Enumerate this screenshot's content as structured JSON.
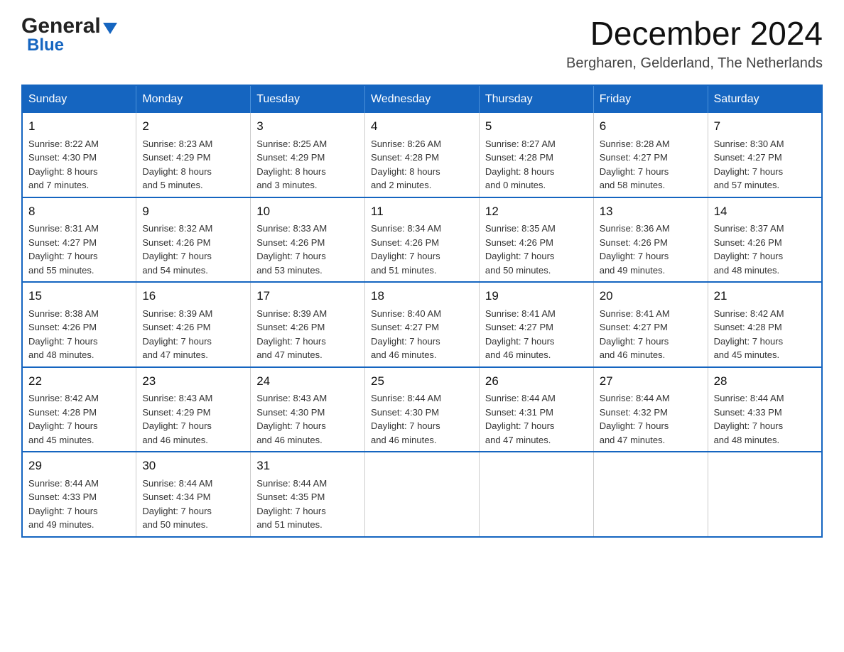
{
  "logo": {
    "general": "General",
    "blue": "Blue",
    "triangle": true
  },
  "title": {
    "month_year": "December 2024",
    "location": "Bergharen, Gelderland, The Netherlands"
  },
  "days_of_week": [
    "Sunday",
    "Monday",
    "Tuesday",
    "Wednesday",
    "Thursday",
    "Friday",
    "Saturday"
  ],
  "weeks": [
    [
      {
        "day": "1",
        "sunrise": "Sunrise: 8:22 AM",
        "sunset": "Sunset: 4:30 PM",
        "daylight": "Daylight: 8 hours",
        "daylight2": "and 7 minutes."
      },
      {
        "day": "2",
        "sunrise": "Sunrise: 8:23 AM",
        "sunset": "Sunset: 4:29 PM",
        "daylight": "Daylight: 8 hours",
        "daylight2": "and 5 minutes."
      },
      {
        "day": "3",
        "sunrise": "Sunrise: 8:25 AM",
        "sunset": "Sunset: 4:29 PM",
        "daylight": "Daylight: 8 hours",
        "daylight2": "and 3 minutes."
      },
      {
        "day": "4",
        "sunrise": "Sunrise: 8:26 AM",
        "sunset": "Sunset: 4:28 PM",
        "daylight": "Daylight: 8 hours",
        "daylight2": "and 2 minutes."
      },
      {
        "day": "5",
        "sunrise": "Sunrise: 8:27 AM",
        "sunset": "Sunset: 4:28 PM",
        "daylight": "Daylight: 8 hours",
        "daylight2": "and 0 minutes."
      },
      {
        "day": "6",
        "sunrise": "Sunrise: 8:28 AM",
        "sunset": "Sunset: 4:27 PM",
        "daylight": "Daylight: 7 hours",
        "daylight2": "and 58 minutes."
      },
      {
        "day": "7",
        "sunrise": "Sunrise: 8:30 AM",
        "sunset": "Sunset: 4:27 PM",
        "daylight": "Daylight: 7 hours",
        "daylight2": "and 57 minutes."
      }
    ],
    [
      {
        "day": "8",
        "sunrise": "Sunrise: 8:31 AM",
        "sunset": "Sunset: 4:27 PM",
        "daylight": "Daylight: 7 hours",
        "daylight2": "and 55 minutes."
      },
      {
        "day": "9",
        "sunrise": "Sunrise: 8:32 AM",
        "sunset": "Sunset: 4:26 PM",
        "daylight": "Daylight: 7 hours",
        "daylight2": "and 54 minutes."
      },
      {
        "day": "10",
        "sunrise": "Sunrise: 8:33 AM",
        "sunset": "Sunset: 4:26 PM",
        "daylight": "Daylight: 7 hours",
        "daylight2": "and 53 minutes."
      },
      {
        "day": "11",
        "sunrise": "Sunrise: 8:34 AM",
        "sunset": "Sunset: 4:26 PM",
        "daylight": "Daylight: 7 hours",
        "daylight2": "and 51 minutes."
      },
      {
        "day": "12",
        "sunrise": "Sunrise: 8:35 AM",
        "sunset": "Sunset: 4:26 PM",
        "daylight": "Daylight: 7 hours",
        "daylight2": "and 50 minutes."
      },
      {
        "day": "13",
        "sunrise": "Sunrise: 8:36 AM",
        "sunset": "Sunset: 4:26 PM",
        "daylight": "Daylight: 7 hours",
        "daylight2": "and 49 minutes."
      },
      {
        "day": "14",
        "sunrise": "Sunrise: 8:37 AM",
        "sunset": "Sunset: 4:26 PM",
        "daylight": "Daylight: 7 hours",
        "daylight2": "and 48 minutes."
      }
    ],
    [
      {
        "day": "15",
        "sunrise": "Sunrise: 8:38 AM",
        "sunset": "Sunset: 4:26 PM",
        "daylight": "Daylight: 7 hours",
        "daylight2": "and 48 minutes."
      },
      {
        "day": "16",
        "sunrise": "Sunrise: 8:39 AM",
        "sunset": "Sunset: 4:26 PM",
        "daylight": "Daylight: 7 hours",
        "daylight2": "and 47 minutes."
      },
      {
        "day": "17",
        "sunrise": "Sunrise: 8:39 AM",
        "sunset": "Sunset: 4:26 PM",
        "daylight": "Daylight: 7 hours",
        "daylight2": "and 47 minutes."
      },
      {
        "day": "18",
        "sunrise": "Sunrise: 8:40 AM",
        "sunset": "Sunset: 4:27 PM",
        "daylight": "Daylight: 7 hours",
        "daylight2": "and 46 minutes."
      },
      {
        "day": "19",
        "sunrise": "Sunrise: 8:41 AM",
        "sunset": "Sunset: 4:27 PM",
        "daylight": "Daylight: 7 hours",
        "daylight2": "and 46 minutes."
      },
      {
        "day": "20",
        "sunrise": "Sunrise: 8:41 AM",
        "sunset": "Sunset: 4:27 PM",
        "daylight": "Daylight: 7 hours",
        "daylight2": "and 46 minutes."
      },
      {
        "day": "21",
        "sunrise": "Sunrise: 8:42 AM",
        "sunset": "Sunset: 4:28 PM",
        "daylight": "Daylight: 7 hours",
        "daylight2": "and 45 minutes."
      }
    ],
    [
      {
        "day": "22",
        "sunrise": "Sunrise: 8:42 AM",
        "sunset": "Sunset: 4:28 PM",
        "daylight": "Daylight: 7 hours",
        "daylight2": "and 45 minutes."
      },
      {
        "day": "23",
        "sunrise": "Sunrise: 8:43 AM",
        "sunset": "Sunset: 4:29 PM",
        "daylight": "Daylight: 7 hours",
        "daylight2": "and 46 minutes."
      },
      {
        "day": "24",
        "sunrise": "Sunrise: 8:43 AM",
        "sunset": "Sunset: 4:30 PM",
        "daylight": "Daylight: 7 hours",
        "daylight2": "and 46 minutes."
      },
      {
        "day": "25",
        "sunrise": "Sunrise: 8:44 AM",
        "sunset": "Sunset: 4:30 PM",
        "daylight": "Daylight: 7 hours",
        "daylight2": "and 46 minutes."
      },
      {
        "day": "26",
        "sunrise": "Sunrise: 8:44 AM",
        "sunset": "Sunset: 4:31 PM",
        "daylight": "Daylight: 7 hours",
        "daylight2": "and 47 minutes."
      },
      {
        "day": "27",
        "sunrise": "Sunrise: 8:44 AM",
        "sunset": "Sunset: 4:32 PM",
        "daylight": "Daylight: 7 hours",
        "daylight2": "and 47 minutes."
      },
      {
        "day": "28",
        "sunrise": "Sunrise: 8:44 AM",
        "sunset": "Sunset: 4:33 PM",
        "daylight": "Daylight: 7 hours",
        "daylight2": "and 48 minutes."
      }
    ],
    [
      {
        "day": "29",
        "sunrise": "Sunrise: 8:44 AM",
        "sunset": "Sunset: 4:33 PM",
        "daylight": "Daylight: 7 hours",
        "daylight2": "and 49 minutes."
      },
      {
        "day": "30",
        "sunrise": "Sunrise: 8:44 AM",
        "sunset": "Sunset: 4:34 PM",
        "daylight": "Daylight: 7 hours",
        "daylight2": "and 50 minutes."
      },
      {
        "day": "31",
        "sunrise": "Sunrise: 8:44 AM",
        "sunset": "Sunset: 4:35 PM",
        "daylight": "Daylight: 7 hours",
        "daylight2": "and 51 minutes."
      },
      null,
      null,
      null,
      null
    ]
  ],
  "colors": {
    "header_bg": "#1565c0",
    "header_text": "#ffffff",
    "border": "#1565c0",
    "cell_border": "#cccccc"
  }
}
